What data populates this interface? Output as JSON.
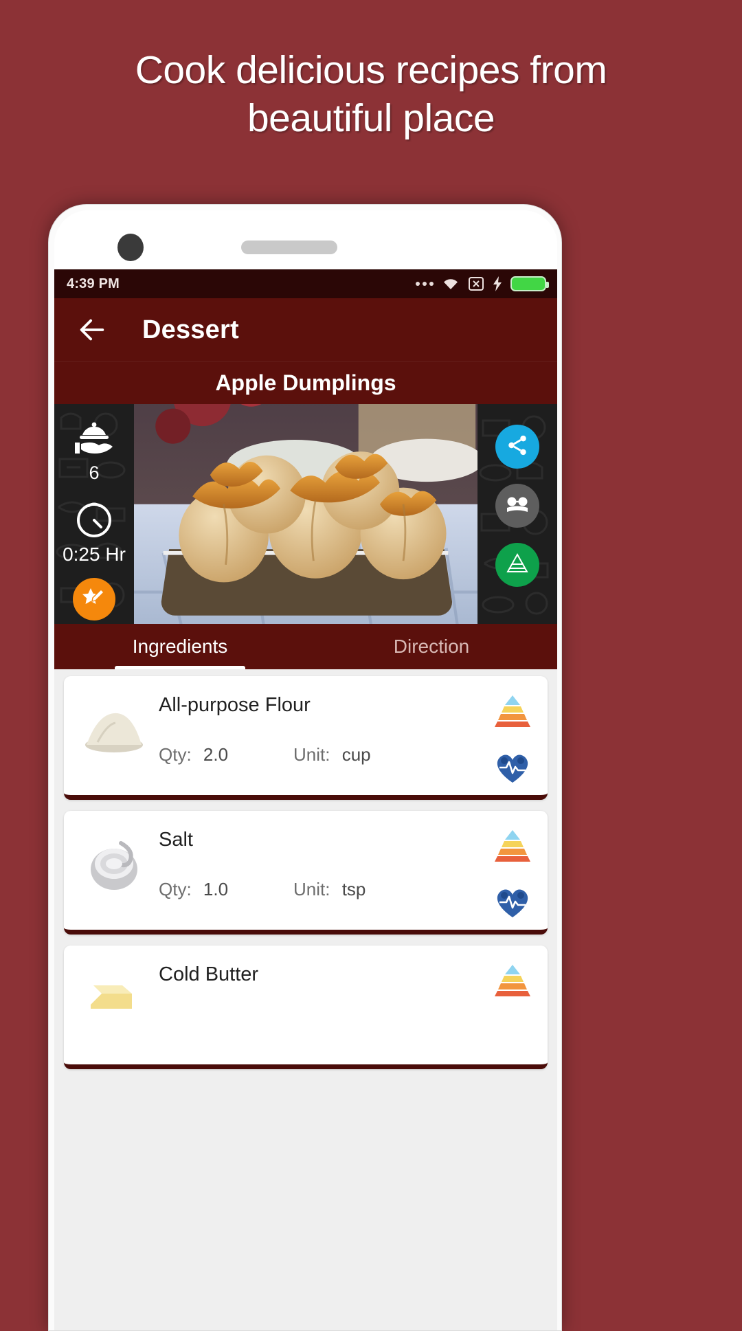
{
  "promo": {
    "line1": "Cook delicious recipes from",
    "line2": "beautiful place"
  },
  "statusbar": {
    "time": "4:39 PM",
    "icons": [
      "more-dots",
      "wifi",
      "x-box",
      "bolt",
      "battery"
    ]
  },
  "appbar": {
    "back_icon": "back-arrow-icon",
    "title": "Dessert"
  },
  "recipe": {
    "title": "Apple Dumplings"
  },
  "hero": {
    "servings_icon": "serving-tray-icon",
    "servings": "6",
    "time_icon": "clock-icon",
    "time": "0:25 Hr",
    "favorite_icon": "star-pencil-icon",
    "actions": [
      {
        "name": "share-button",
        "icon": "share-icon",
        "color": "#17a9e0"
      },
      {
        "name": "read-button",
        "icon": "book-glasses-icon",
        "color": "#5e5e5e"
      },
      {
        "name": "pyramid-button",
        "icon": "food-pyramid-icon",
        "color": "#0ea14b"
      }
    ]
  },
  "tabs": [
    {
      "label": "Ingredients",
      "active": true
    },
    {
      "label": "Direction",
      "active": false
    }
  ],
  "ingredients": {
    "qty_label": "Qty:",
    "unit_label": "Unit:",
    "items": [
      {
        "name": "All-purpose Flour",
        "qty": "2.0",
        "unit": "cup",
        "thumb": "flour-pile-icon"
      },
      {
        "name": "Salt",
        "qty": "1.0",
        "unit": "tsp",
        "thumb": "salt-bowl-icon"
      },
      {
        "name": "Cold Butter",
        "qty": "",
        "unit": "",
        "thumb": "butter-icon"
      }
    ]
  },
  "colors": {
    "page_bg": "#8c3236",
    "appbar": "#5b100c",
    "statusbar": "#2b0706",
    "accent_orange": "#f5880c",
    "card_underline": "#4a0c09"
  }
}
